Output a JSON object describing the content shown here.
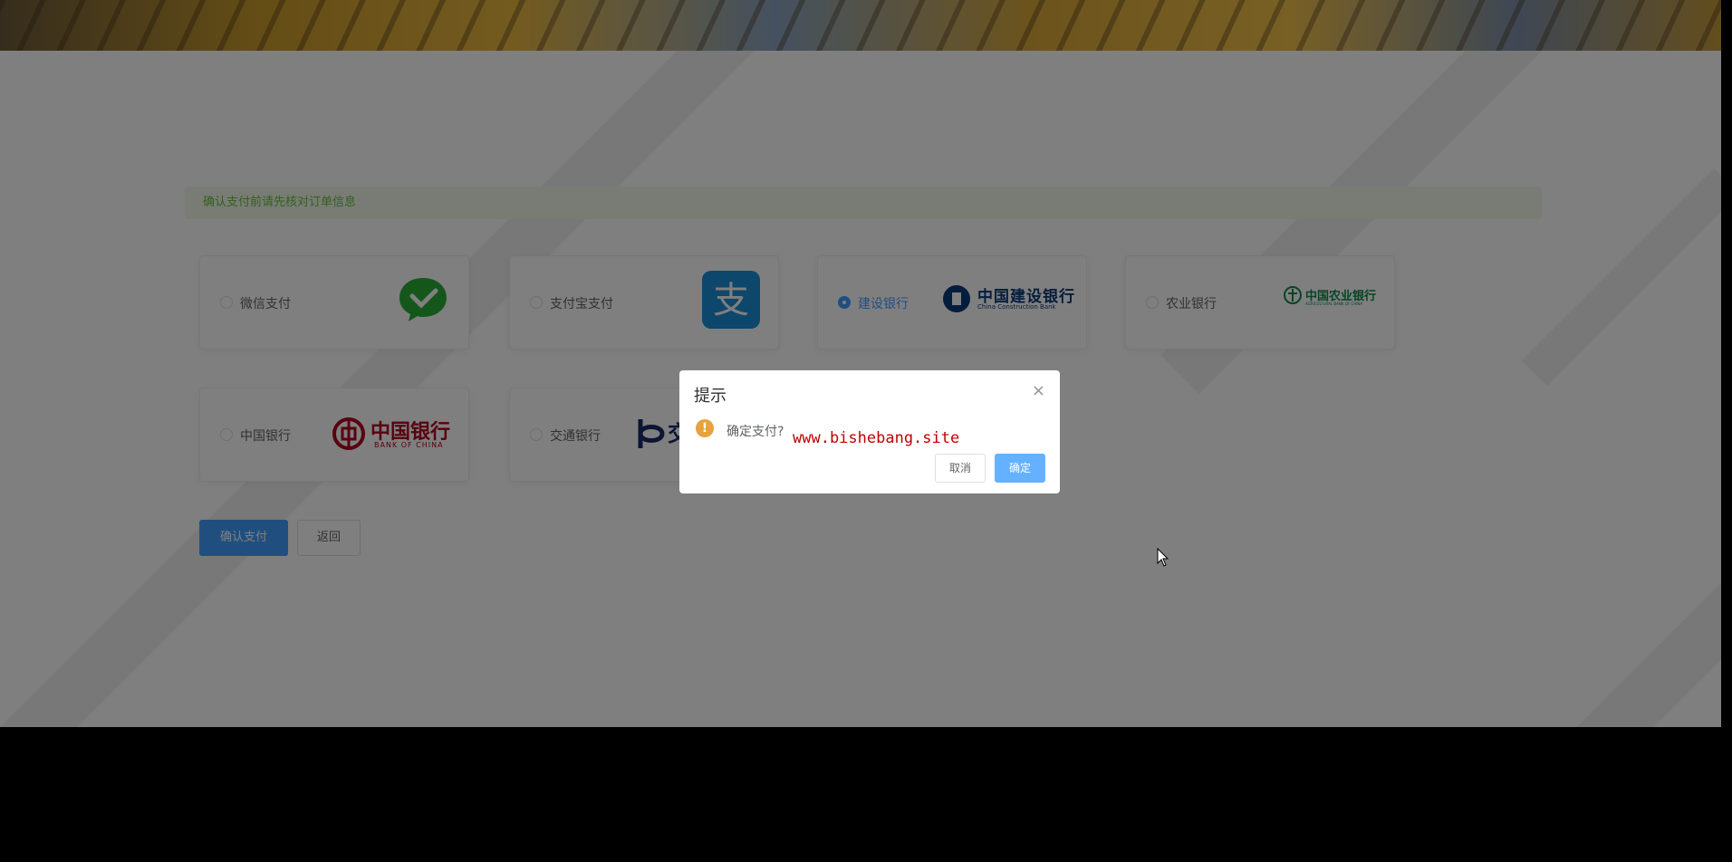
{
  "alert": {
    "text": "确认支付前请先核对订单信息"
  },
  "payment_methods": [
    {
      "label": "微信支付",
      "selected": false,
      "icon": "wechat-pay-logo"
    },
    {
      "label": "支付宝支付",
      "selected": false,
      "icon": "alipay-logo"
    },
    {
      "label": "建设银行",
      "selected": true,
      "icon": "ccb-logo",
      "logo_text": "中国建设银行",
      "logo_sub": "China Construction Bank"
    },
    {
      "label": "农业银行",
      "selected": false,
      "icon": "abc-logo",
      "logo_text": "中国农业银行",
      "logo_sub": "AGRICULTURAL BANK OF CHINA"
    },
    {
      "label": "中国银行",
      "selected": false,
      "icon": "boc-logo",
      "logo_text": "中国银行",
      "logo_sub": "BANK OF CHINA"
    },
    {
      "label": "交通银行",
      "selected": false,
      "icon": "bocom-logo",
      "logo_text": "交"
    }
  ],
  "actions": {
    "confirm_label": "确认支付",
    "back_label": "返回"
  },
  "dialog": {
    "title": "提示",
    "message": "确定支付?",
    "watermark": "www.bishebang.site",
    "cancel_label": "取消",
    "ok_label": "确定"
  },
  "colors": {
    "primary": "#409eff",
    "success": "#67c23a",
    "warning": "#e6a23c"
  }
}
